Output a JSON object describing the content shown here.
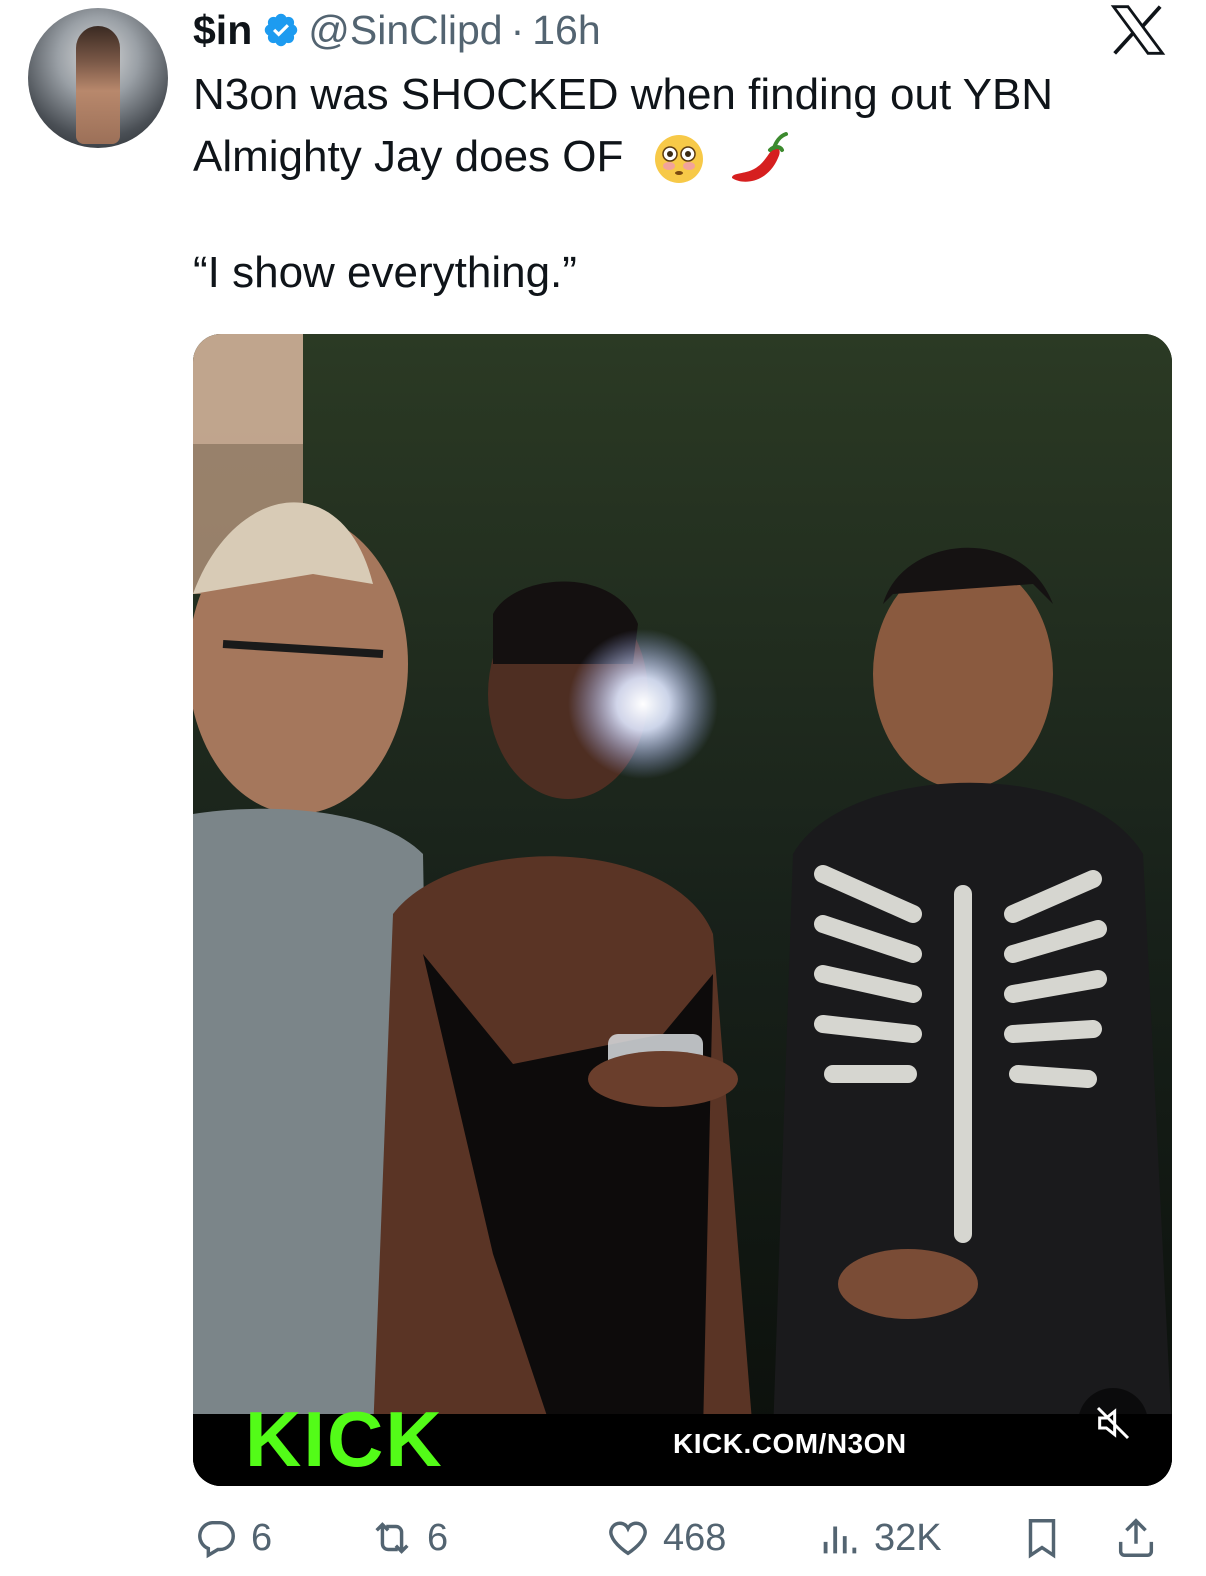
{
  "tweet": {
    "display_name": "$in",
    "handle": "@SinClipd",
    "separator": "·",
    "time": "16h",
    "text_line1": "N3on was SHOCKED when finding out YBN",
    "text_line2": "Almighty Jay does OF",
    "emojis": [
      "flushed-face",
      "hot-pepper"
    ],
    "quote": "“I show everything.”"
  },
  "media": {
    "watermark_logo": "KICK",
    "watermark_url": "KICK.COM/N3ON",
    "muted": true
  },
  "actions": {
    "replies": "6",
    "reposts": "6",
    "likes": "468",
    "views": "32K"
  },
  "colors": {
    "verified": "#1d9bf0",
    "secondary_text": "#536471",
    "kick_green": "#53fc18"
  }
}
